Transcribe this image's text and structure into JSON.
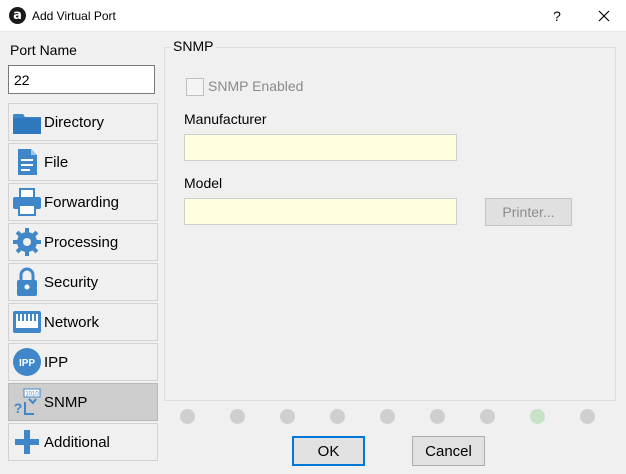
{
  "window": {
    "title": "Add Virtual Port",
    "app_icon_glyph": "a",
    "help_label": "?",
    "close_icon": "close-icon"
  },
  "port": {
    "label": "Port Name",
    "value": "22"
  },
  "sidebar": {
    "selected_index": 7,
    "items": [
      {
        "label": "Directory",
        "icon": "folder-icon"
      },
      {
        "label": "File",
        "icon": "document-icon"
      },
      {
        "label": "Forwarding",
        "icon": "printer-icon"
      },
      {
        "label": "Processing",
        "icon": "gear-icon"
      },
      {
        "label": "Security",
        "icon": "lock-icon"
      },
      {
        "label": "Network",
        "icon": "network-port-icon"
      },
      {
        "label": "IPP",
        "icon": "ipp-icon",
        "icon_text": "IPP"
      },
      {
        "label": "SNMP",
        "icon": "snmp-icon",
        "icon_text": "1010"
      },
      {
        "label": "Additional",
        "icon": "plus-icon"
      }
    ]
  },
  "snmp": {
    "group_title": "SNMP",
    "enabled_label": "SNMP Enabled",
    "enabled": false,
    "manufacturer_label": "Manufacturer",
    "manufacturer_value": "",
    "model_label": "Model",
    "model_value": "",
    "printer_button": "Printer..."
  },
  "pager": {
    "count": 9,
    "active_index": 7,
    "colors": {
      "inactive": "#cfcfcf",
      "active": "#c7e3c7"
    }
  },
  "buttons": {
    "ok": "OK",
    "cancel": "Cancel"
  },
  "colors": {
    "field_background": "#ffffdd",
    "sidebar_selected": "#cdcdcd",
    "icon_blue": "#3f87c9",
    "focus_border": "#0078d7"
  }
}
